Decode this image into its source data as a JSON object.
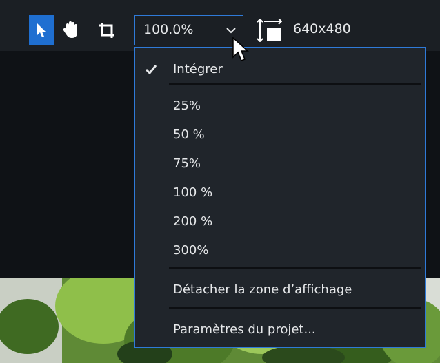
{
  "toolbar": {
    "tools": [
      {
        "icon": "pointer-icon",
        "active": true
      },
      {
        "icon": "hand-icon",
        "active": false
      },
      {
        "icon": "crop-icon",
        "active": false
      }
    ],
    "zoom_value": "100.0%",
    "resolution": "640x480",
    "accent_color": "#1f6fd1"
  },
  "zoom_menu": {
    "fit_label": "Intégrer",
    "fit_checked": true,
    "zoom_options": [
      "25%",
      "50 %",
      "75%",
      "100 %",
      "200 %",
      "300%"
    ],
    "detach_label": "Détacher la zone d’affichage",
    "project_settings_label": "Paramètres du projet..."
  }
}
